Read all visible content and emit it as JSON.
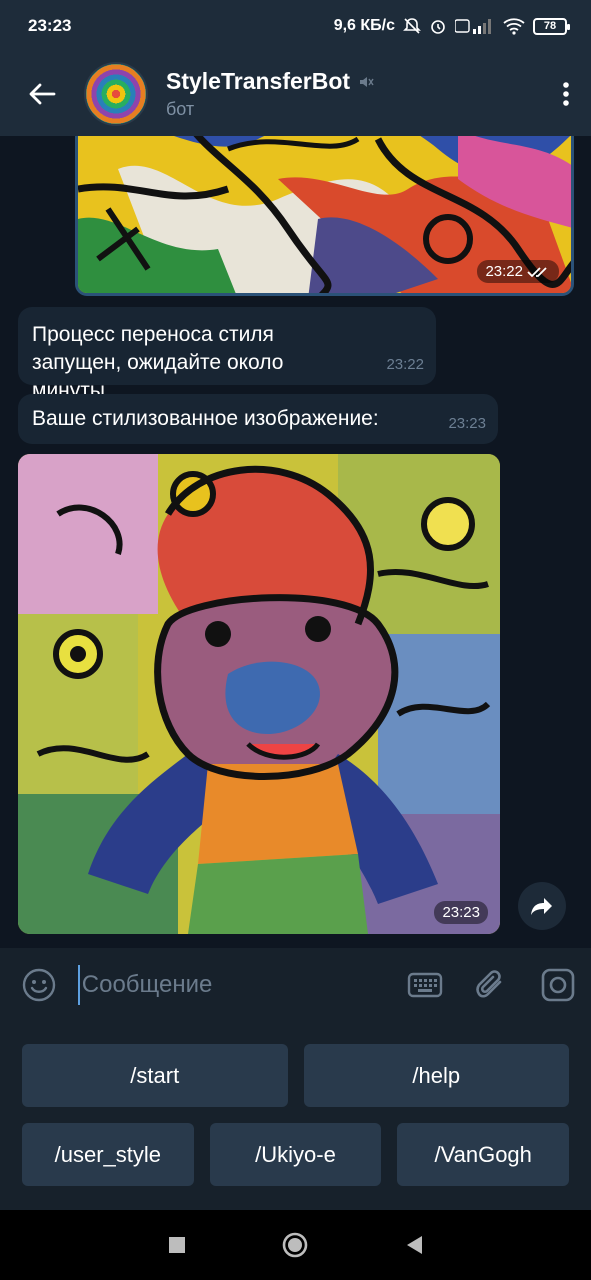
{
  "status_bar": {
    "time": "23:23",
    "network_speed": "9,6 КБ/с",
    "battery": "78"
  },
  "header": {
    "title": "StyleTransferBot",
    "subtitle": "бот"
  },
  "messages": {
    "photo_out_time": "23:22",
    "msg1_text": "Процесс переноса стиля запущен, ожидайте около минуты.",
    "msg1_time": "23:22",
    "msg2_text": "Ваше стилизованное изображение:",
    "msg2_time": "23:23",
    "photo_in_time": "23:23"
  },
  "composer": {
    "placeholder": "Сообщение"
  },
  "keyboard": {
    "row1": [
      "/start",
      "/help"
    ],
    "row2": [
      "/user_style",
      "/Ukiyo-e",
      "/VanGogh"
    ]
  },
  "colors": {
    "background": "#0e1621",
    "header": "#1e2c3a",
    "bubble_in": "#182533",
    "keyboard_button": "#293a4c",
    "accent": "#5ea0e0"
  }
}
